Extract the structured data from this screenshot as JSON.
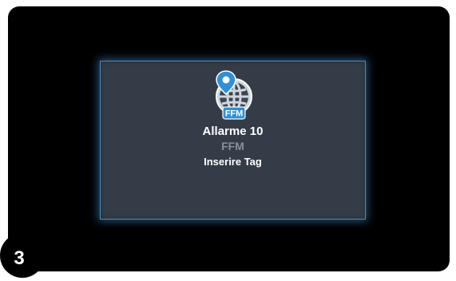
{
  "dialog": {
    "icon": "ffm-globe-location-icon",
    "icon_label": "FFM",
    "title": "Allarme 10",
    "subtitle": "FFM",
    "message": "Inserire Tag"
  },
  "step_badge": "3",
  "colors": {
    "screen_bg": "#000000",
    "dialog_bg": "#343d47",
    "dialog_border": "#4a8fc4",
    "icon_blue": "#2f8fd8",
    "subtitle_gray": "#8a8f96"
  }
}
